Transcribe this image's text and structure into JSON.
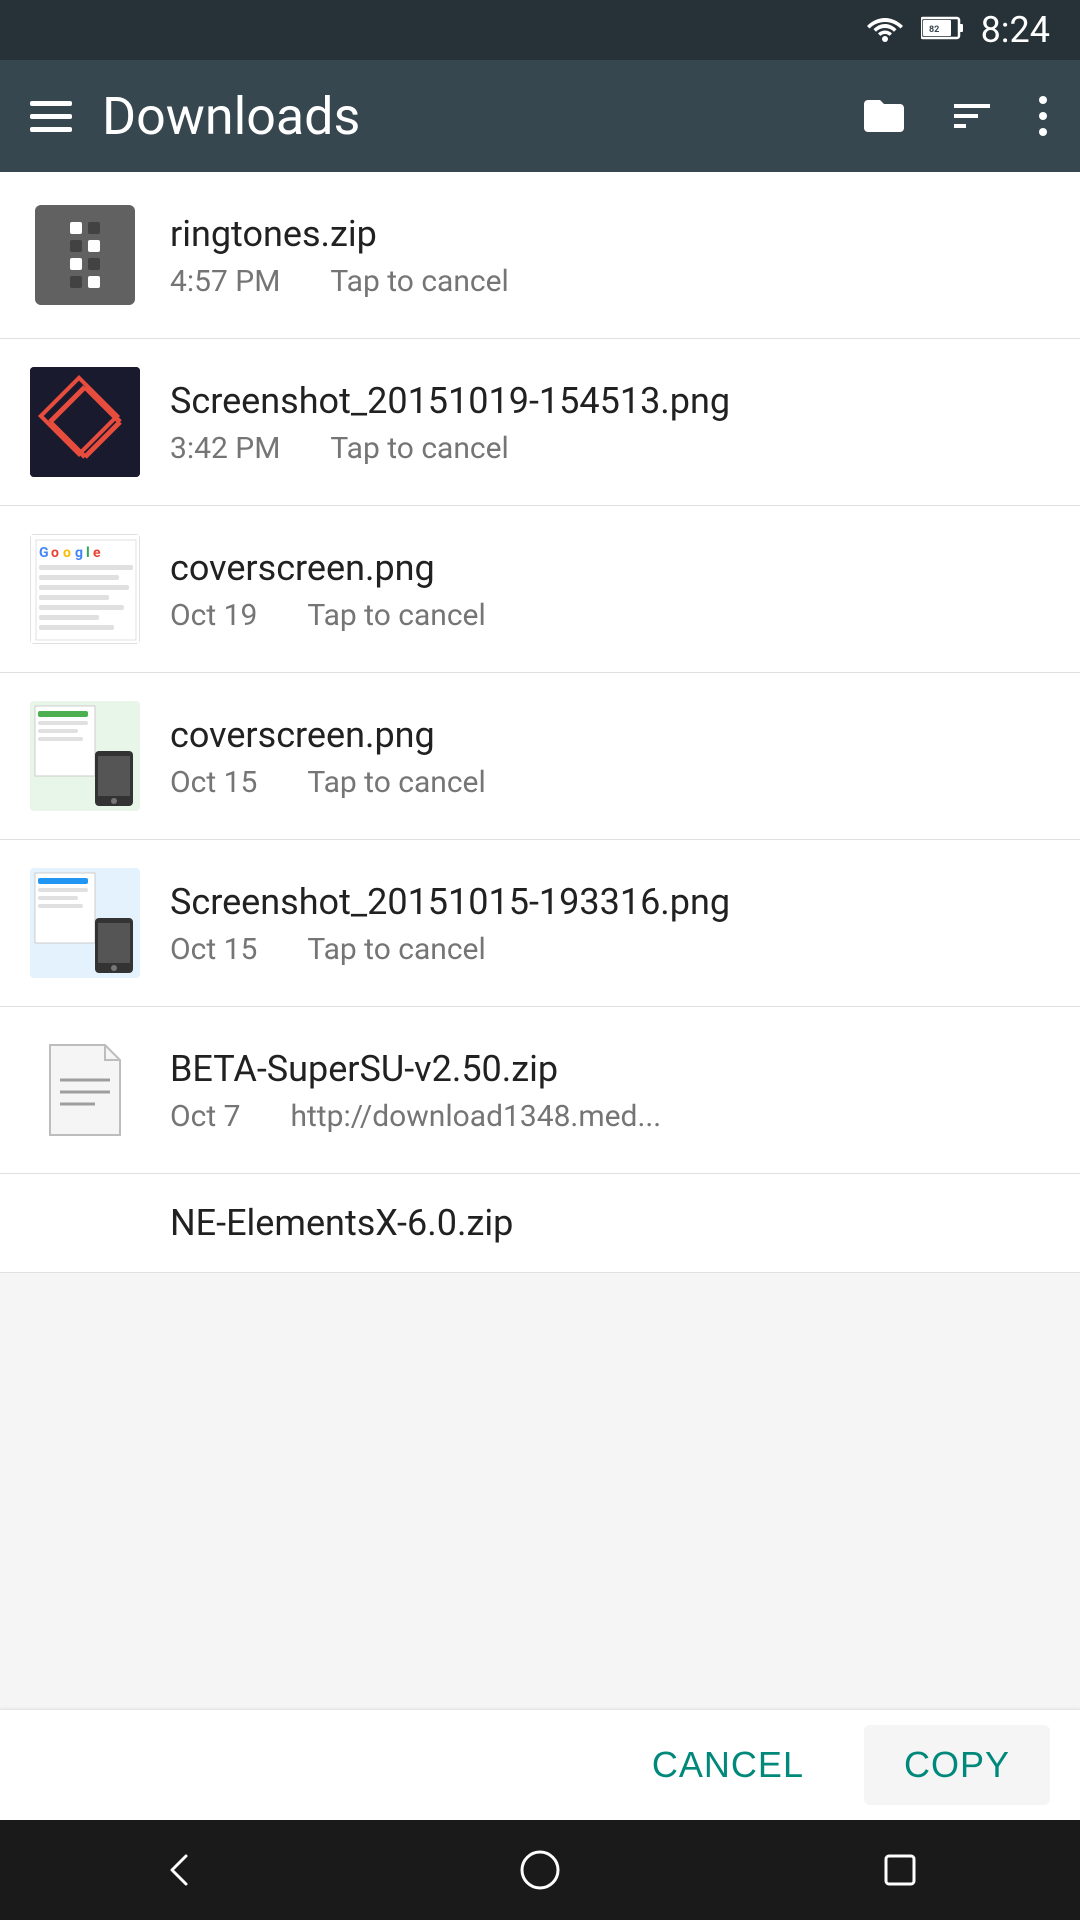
{
  "statusBar": {
    "time": "8:24",
    "wifiIcon": "wifi-icon",
    "batteryIcon": "battery-icon",
    "batteryLevel": "82"
  },
  "appBar": {
    "menuIcon": "menu-icon",
    "title": "Downloads",
    "folderIcon": "folder-icon",
    "sortIcon": "sort-icon",
    "moreIcon": "more-icon"
  },
  "files": [
    {
      "id": 1,
      "name": "ringtones.zip",
      "time": "4:57 PM",
      "action": "Tap to cancel",
      "type": "zip",
      "thumb": "zip"
    },
    {
      "id": 2,
      "name": "Screenshot_20151019-154513.png",
      "time": "3:42 PM",
      "action": "Tap to cancel",
      "type": "image",
      "thumb": "screenshot1"
    },
    {
      "id": 3,
      "name": "coverscreen.png",
      "time": "Oct 19",
      "action": "Tap to cancel",
      "type": "image",
      "thumb": "coverscreen1"
    },
    {
      "id": 4,
      "name": "coverscreen.png",
      "time": "Oct 15",
      "action": "Tap to cancel",
      "type": "image",
      "thumb": "coverscreen2"
    },
    {
      "id": 5,
      "name": "Screenshot_20151015-193316.png",
      "time": "Oct 15",
      "action": "Tap to cancel",
      "type": "image",
      "thumb": "screenshot2"
    },
    {
      "id": 6,
      "name": "BETA-SuperSU-v2.50.zip",
      "time": "Oct 7",
      "action": "http://download1348.med...",
      "type": "zip",
      "thumb": "doc"
    }
  ],
  "partialFile": {
    "name": "NE-ElementsX-6.0.zip"
  },
  "actions": {
    "cancel": "CANCEL",
    "copy": "COPY"
  },
  "navBar": {
    "backIcon": "back-icon",
    "homeIcon": "home-icon",
    "recentIcon": "recent-icon"
  }
}
